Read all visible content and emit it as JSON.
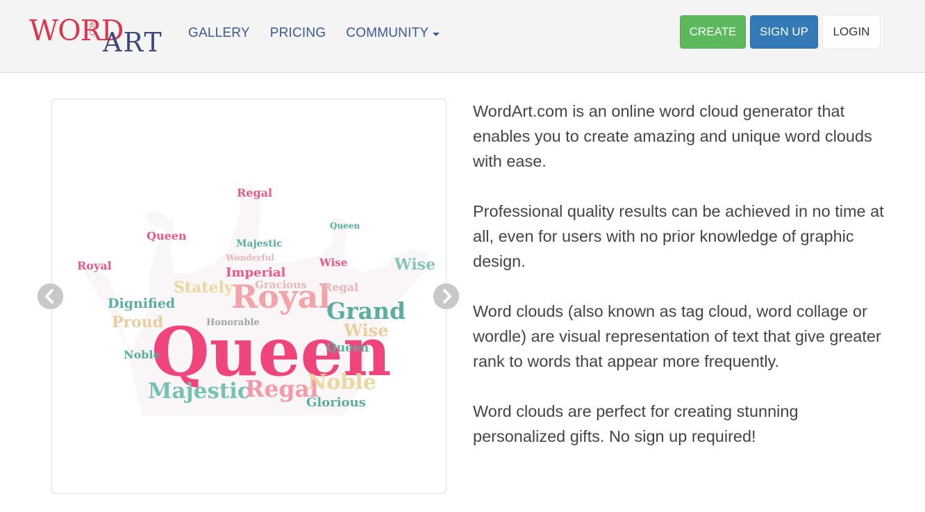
{
  "brand": {
    "logo_word": "WORD",
    "logo_small": ".COM",
    "logo_art": "ART",
    "colors": {
      "red": "#d9384e",
      "navy": "#3b4a7a"
    }
  },
  "nav": {
    "links": [
      {
        "label": "GALLERY"
      },
      {
        "label": "PRICING"
      },
      {
        "label": "COMMUNITY"
      }
    ],
    "create_label": "CREATE",
    "signup_label": "SIGN UP",
    "login_label": "LOGIN"
  },
  "carousel": {
    "prev_icon": "chevron-left-icon",
    "next_icon": "chevron-right-icon",
    "words": {
      "main": "Queen",
      "royal": "Royal",
      "grand": "Grand",
      "majestic": "Majestic",
      "regal": "Regal",
      "noble": "Noble",
      "proud": "Proud",
      "dignified": "Dignified",
      "imperial": "Imperial",
      "stately": "Stately",
      "gracious": "Gracious",
      "wise": "Wise",
      "glorious": "Glorious",
      "honorable": "Honorable",
      "wonderful": "Wonderful"
    }
  },
  "description": {
    "p1": "WordArt.com is an online word cloud generator that enables you to create amazing and unique word clouds with ease.",
    "p2": "Professional quality results can be achieved in no time at all, even for users with no prior knowledge of graphic design.",
    "p3": "Word clouds (also known as tag cloud, word collage or wordle) are visual representation of text that give greater rank to words that appear more frequently.",
    "p4": "Word clouds are perfect for creating stunning personalized gifts. No sign up required!"
  }
}
